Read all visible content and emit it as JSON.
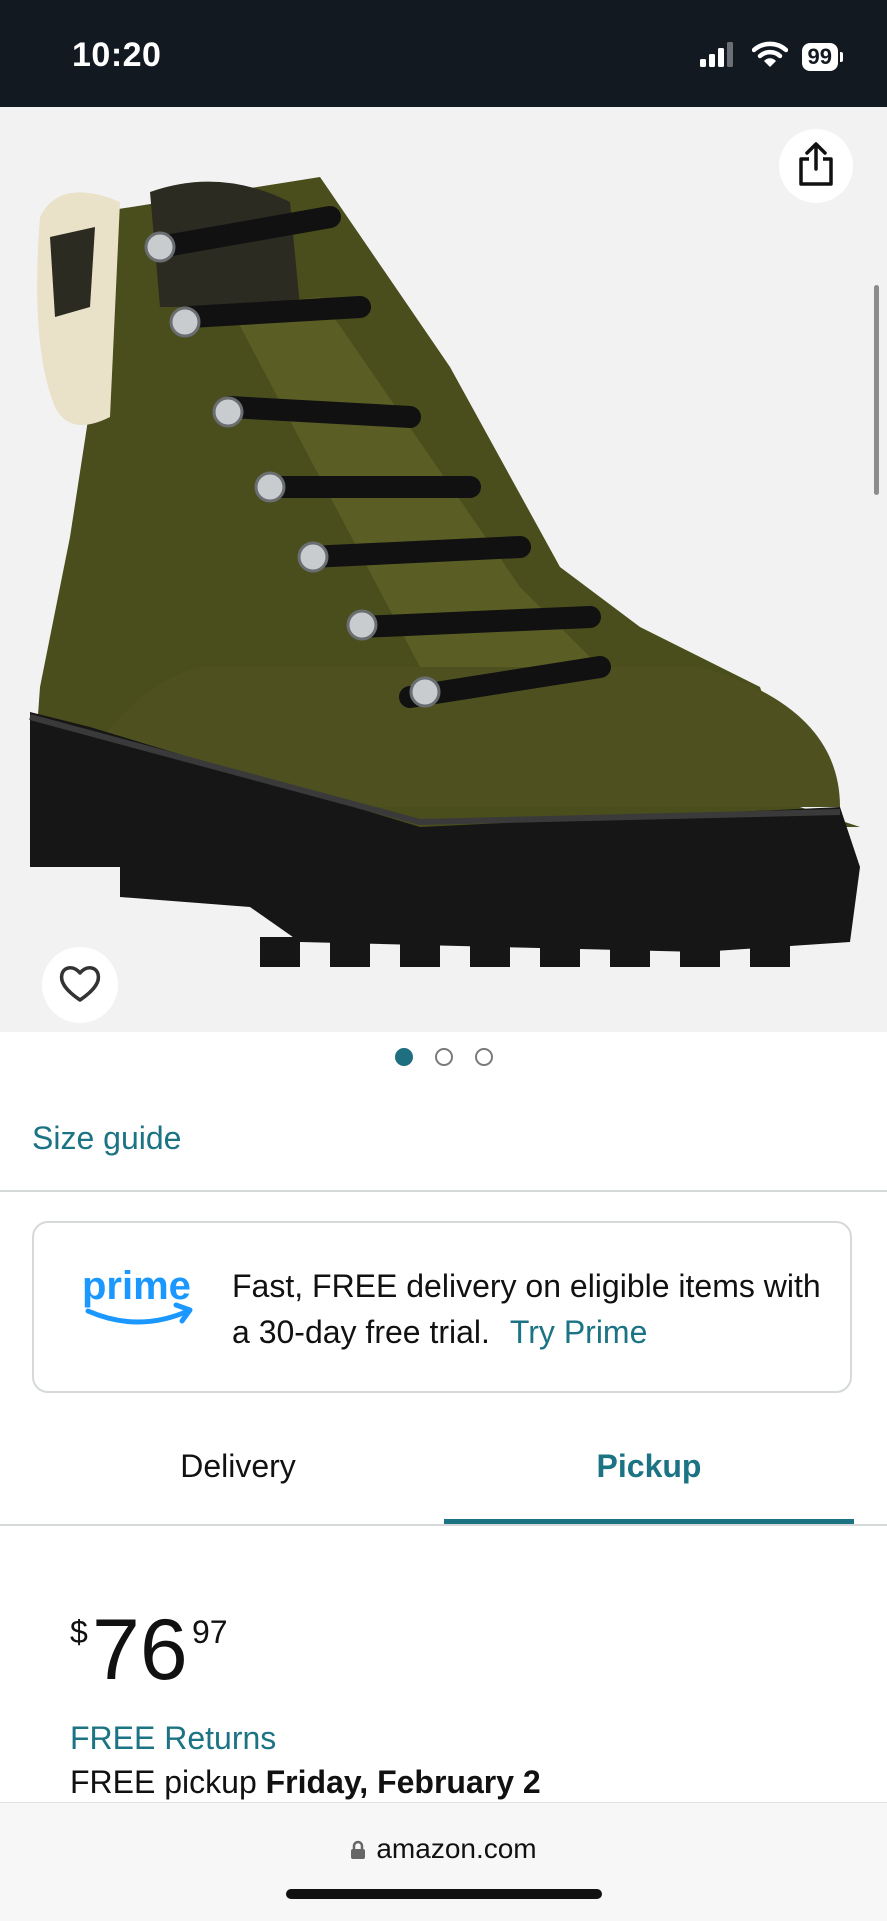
{
  "status_bar": {
    "time": "10:20",
    "battery": "99",
    "icons": [
      "cellular-signal-icon",
      "wifi-icon",
      "battery-icon"
    ]
  },
  "product_image": {
    "description_icon": "boot-image",
    "share_icon": "share-icon",
    "favorite_icon": "heart-icon",
    "carousel": {
      "count": 3,
      "active_index": 0
    }
  },
  "size_guide": {
    "label": "Size guide"
  },
  "prime_banner": {
    "logo_text": "prime",
    "message": "Fast, FREE delivery on eligible items with a 30-day free trial.",
    "cta": "Try Prime"
  },
  "tabs": [
    {
      "label": "Delivery",
      "active": false
    },
    {
      "label": "Pickup",
      "active": true
    }
  ],
  "price": {
    "symbol": "$",
    "whole": "76",
    "fraction": "97"
  },
  "returns": {
    "label": "FREE Returns"
  },
  "pickup": {
    "prefix": "FREE pickup ",
    "date": "Friday, February 2"
  },
  "browser": {
    "url": "amazon.com"
  },
  "colors": {
    "accent": "#1b7383",
    "status_bar_bg": "#131921",
    "prime_blue": "#1a98ff"
  }
}
